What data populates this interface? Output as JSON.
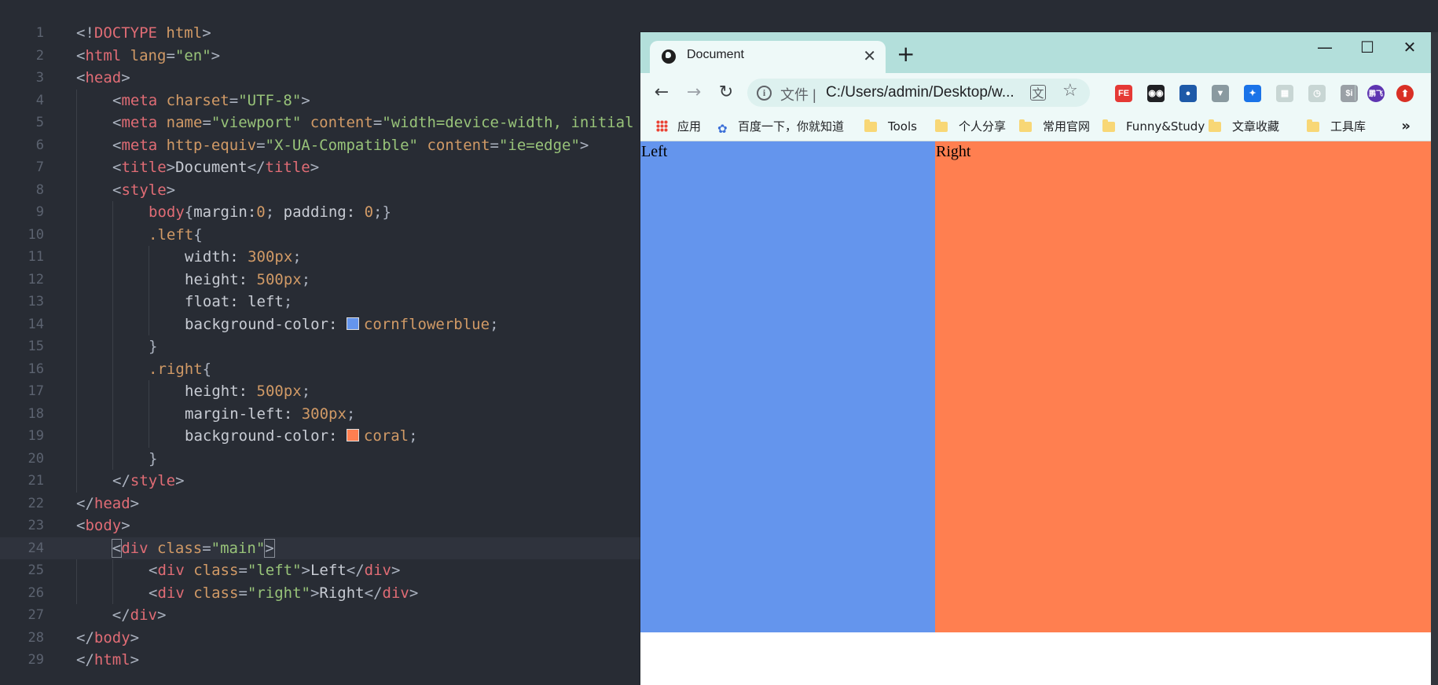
{
  "editor": {
    "lines": [
      {
        "n": "1",
        "indent": 0,
        "html": [
          [
            "t-punc",
            "<!"
          ],
          [
            "t-tag",
            "DOCTYPE"
          ],
          [
            "t-text",
            " "
          ],
          [
            "t-attr",
            "html"
          ],
          [
            "t-punc",
            ">"
          ]
        ]
      },
      {
        "n": "2",
        "indent": 0,
        "html": [
          [
            "t-punc",
            "<"
          ],
          [
            "t-tag",
            "html"
          ],
          [
            "t-text",
            " "
          ],
          [
            "t-attr",
            "lang"
          ],
          [
            "t-punc",
            "="
          ],
          [
            "t-str",
            "\"en\""
          ],
          [
            "t-punc",
            ">"
          ]
        ]
      },
      {
        "n": "3",
        "indent": 0,
        "html": [
          [
            "t-punc",
            "<"
          ],
          [
            "t-tag",
            "head"
          ],
          [
            "t-punc",
            ">"
          ]
        ]
      },
      {
        "n": "4",
        "indent": 1,
        "html": [
          [
            "t-punc",
            "<"
          ],
          [
            "t-tag",
            "meta"
          ],
          [
            "t-text",
            " "
          ],
          [
            "t-attr",
            "charset"
          ],
          [
            "t-punc",
            "="
          ],
          [
            "t-str",
            "\"UTF-8\""
          ],
          [
            "t-punc",
            ">"
          ]
        ]
      },
      {
        "n": "5",
        "indent": 1,
        "html": [
          [
            "t-punc",
            "<"
          ],
          [
            "t-tag",
            "meta"
          ],
          [
            "t-text",
            " "
          ],
          [
            "t-attr",
            "name"
          ],
          [
            "t-punc",
            "="
          ],
          [
            "t-str",
            "\"viewport\""
          ],
          [
            "t-text",
            " "
          ],
          [
            "t-attr",
            "content"
          ],
          [
            "t-punc",
            "="
          ],
          [
            "t-str",
            "\"width=device-width, initial"
          ]
        ]
      },
      {
        "n": "6",
        "indent": 1,
        "html": [
          [
            "t-punc",
            "<"
          ],
          [
            "t-tag",
            "meta"
          ],
          [
            "t-text",
            " "
          ],
          [
            "t-attr",
            "http-equiv"
          ],
          [
            "t-punc",
            "="
          ],
          [
            "t-str",
            "\"X-UA-Compatible\""
          ],
          [
            "t-text",
            " "
          ],
          [
            "t-attr",
            "content"
          ],
          [
            "t-punc",
            "="
          ],
          [
            "t-str",
            "\"ie=edge\""
          ],
          [
            "t-punc",
            ">"
          ]
        ]
      },
      {
        "n": "7",
        "indent": 1,
        "html": [
          [
            "t-punc",
            "<"
          ],
          [
            "t-tag",
            "title"
          ],
          [
            "t-punc",
            ">"
          ],
          [
            "t-text",
            "Document"
          ],
          [
            "t-punc",
            "</"
          ],
          [
            "t-tag",
            "title"
          ],
          [
            "t-punc",
            ">"
          ]
        ]
      },
      {
        "n": "8",
        "indent": 1,
        "html": [
          [
            "t-punc",
            "<"
          ],
          [
            "t-tag",
            "style"
          ],
          [
            "t-punc",
            ">"
          ]
        ]
      },
      {
        "n": "9",
        "indent": 2,
        "html": [
          [
            "t-sel",
            "body"
          ],
          [
            "t-punc",
            "{"
          ],
          [
            "t-prop",
            "margin:"
          ],
          [
            "t-num",
            "0"
          ],
          [
            "t-punc",
            "; "
          ],
          [
            "t-prop",
            "padding: "
          ],
          [
            "t-num",
            "0"
          ],
          [
            "t-punc",
            ";}"
          ]
        ]
      },
      {
        "n": "10",
        "indent": 2,
        "html": [
          [
            "t-cls",
            ".left"
          ],
          [
            "t-punc",
            "{"
          ]
        ]
      },
      {
        "n": "11",
        "indent": 3,
        "html": [
          [
            "t-prop",
            "width: "
          ],
          [
            "t-num",
            "300px"
          ],
          [
            "t-punc",
            ";"
          ]
        ]
      },
      {
        "n": "12",
        "indent": 3,
        "html": [
          [
            "t-prop",
            "height: "
          ],
          [
            "t-num",
            "500px"
          ],
          [
            "t-punc",
            ";"
          ]
        ]
      },
      {
        "n": "13",
        "indent": 3,
        "html": [
          [
            "t-prop",
            "float: left"
          ],
          [
            "t-punc",
            ";"
          ]
        ]
      },
      {
        "n": "14",
        "indent": 3,
        "html": [
          [
            "t-prop",
            "background-color: "
          ],
          [
            "swatch",
            "#6495ed"
          ],
          [
            "t-num",
            "cornflowerblue"
          ],
          [
            "t-punc",
            ";"
          ]
        ]
      },
      {
        "n": "15",
        "indent": 2,
        "html": [
          [
            "t-punc",
            "}"
          ]
        ]
      },
      {
        "n": "16",
        "indent": 2,
        "html": [
          [
            "t-cls",
            ".right"
          ],
          [
            "t-punc",
            "{"
          ]
        ]
      },
      {
        "n": "17",
        "indent": 3,
        "html": [
          [
            "t-prop",
            "height: "
          ],
          [
            "t-num",
            "500px"
          ],
          [
            "t-punc",
            ";"
          ]
        ]
      },
      {
        "n": "18",
        "indent": 3,
        "html": [
          [
            "t-prop",
            "margin-left: "
          ],
          [
            "t-num",
            "300px"
          ],
          [
            "t-punc",
            ";"
          ]
        ]
      },
      {
        "n": "19",
        "indent": 3,
        "html": [
          [
            "t-prop",
            "background-color: "
          ],
          [
            "swatch",
            "#ff7f50"
          ],
          [
            "t-num",
            "coral"
          ],
          [
            "t-punc",
            ";"
          ]
        ]
      },
      {
        "n": "20",
        "indent": 2,
        "html": [
          [
            "t-punc",
            "}"
          ]
        ]
      },
      {
        "n": "21",
        "indent": 1,
        "html": [
          [
            "t-punc",
            "</"
          ],
          [
            "t-tag",
            "style"
          ],
          [
            "t-punc",
            ">"
          ]
        ]
      },
      {
        "n": "22",
        "indent": 0,
        "html": [
          [
            "t-punc",
            "</"
          ],
          [
            "t-tag",
            "head"
          ],
          [
            "t-punc",
            ">"
          ]
        ]
      },
      {
        "n": "23",
        "indent": 0,
        "html": [
          [
            "t-punc",
            "<"
          ],
          [
            "t-tag",
            "body"
          ],
          [
            "t-punc",
            ">"
          ]
        ]
      },
      {
        "n": "24",
        "indent": 0,
        "active": true,
        "html": [
          [
            "t-text",
            "    "
          ],
          [
            "bracket",
            "<"
          ],
          [
            "t-tag",
            "div"
          ],
          [
            "t-text",
            " "
          ],
          [
            "t-attr",
            "class"
          ],
          [
            "t-punc",
            "="
          ],
          [
            "t-str",
            "\"main\""
          ],
          [
            "bracket",
            ">"
          ]
        ]
      },
      {
        "n": "25",
        "indent": 2,
        "html": [
          [
            "t-punc",
            "<"
          ],
          [
            "t-tag",
            "div"
          ],
          [
            "t-text",
            " "
          ],
          [
            "t-attr",
            "class"
          ],
          [
            "t-punc",
            "="
          ],
          [
            "t-str",
            "\"left\""
          ],
          [
            "t-punc",
            ">"
          ],
          [
            "t-text",
            "Left"
          ],
          [
            "t-punc",
            "</"
          ],
          [
            "t-tag",
            "div"
          ],
          [
            "t-punc",
            ">"
          ]
        ]
      },
      {
        "n": "26",
        "indent": 2,
        "html": [
          [
            "t-punc",
            "<"
          ],
          [
            "t-tag",
            "div"
          ],
          [
            "t-text",
            " "
          ],
          [
            "t-attr",
            "class"
          ],
          [
            "t-punc",
            "="
          ],
          [
            "t-str",
            "\"right\""
          ],
          [
            "t-punc",
            ">"
          ],
          [
            "t-text",
            "Right"
          ],
          [
            "t-punc",
            "</"
          ],
          [
            "t-tag",
            "div"
          ],
          [
            "t-punc",
            ">"
          ]
        ]
      },
      {
        "n": "27",
        "indent": 0,
        "html": [
          [
            "t-text",
            "    "
          ],
          [
            "t-punc",
            "</"
          ],
          [
            "t-tag",
            "div"
          ],
          [
            "t-punc",
            ">"
          ]
        ]
      },
      {
        "n": "28",
        "indent": 0,
        "html": [
          [
            "t-punc",
            "</"
          ],
          [
            "t-tag",
            "body"
          ],
          [
            "t-punc",
            ">"
          ]
        ]
      },
      {
        "n": "29",
        "indent": 0,
        "html": [
          [
            "t-punc",
            "</"
          ],
          [
            "t-tag",
            "html"
          ],
          [
            "t-punc",
            ">"
          ]
        ]
      }
    ]
  },
  "browser": {
    "tab_title": "Document",
    "tab_close": "✕",
    "new_tab": "+",
    "window_controls": {
      "minimize": "—",
      "maximize": "☐",
      "close": "✕"
    },
    "nav": {
      "back": "←",
      "forward": "→",
      "reload": "↻"
    },
    "omnibox": {
      "scheme_label": "文件 |",
      "url": "C:/Users/admin/Desktop/w...",
      "info_icon": "i"
    },
    "extensions": [
      {
        "name": "fe-extension-icon",
        "label": "FE",
        "color": "#e53935"
      },
      {
        "name": "eyes-extension-icon",
        "label": "◉◉",
        "color": "#202124"
      },
      {
        "name": "fox-extension-icon",
        "label": "●",
        "color": "#1e5aa8"
      },
      {
        "name": "vue-extension-icon",
        "label": "▼",
        "color": "#8a9aa0"
      },
      {
        "name": "globe-extension-icon",
        "label": "✦",
        "color": "#1a73e8"
      },
      {
        "name": "qr-extension-icon",
        "label": "▦",
        "color": "#c8d6d4"
      },
      {
        "name": "clock-extension-icon",
        "label": "◷",
        "color": "#c8d6d4"
      },
      {
        "name": "price-extension-icon",
        "label": "$i",
        "color": "#9aa0a6"
      }
    ],
    "profile_label": "鹏飞",
    "update_label": "⬆",
    "bookmarks": {
      "apps": "应用",
      "baidu": "百度一下，你就知道",
      "folders": [
        "Tools",
        "个人分享",
        "常用官网",
        "Funny&Study",
        "文章收藏",
        "工具库"
      ],
      "more": "»"
    },
    "page": {
      "left_text": "Left",
      "right_text": "Right"
    }
  },
  "colors": {
    "editor_bg": "#282c34",
    "left_box": "#6495ed",
    "right_box": "#ff7f50",
    "titlebar": "#b3dfdb"
  }
}
